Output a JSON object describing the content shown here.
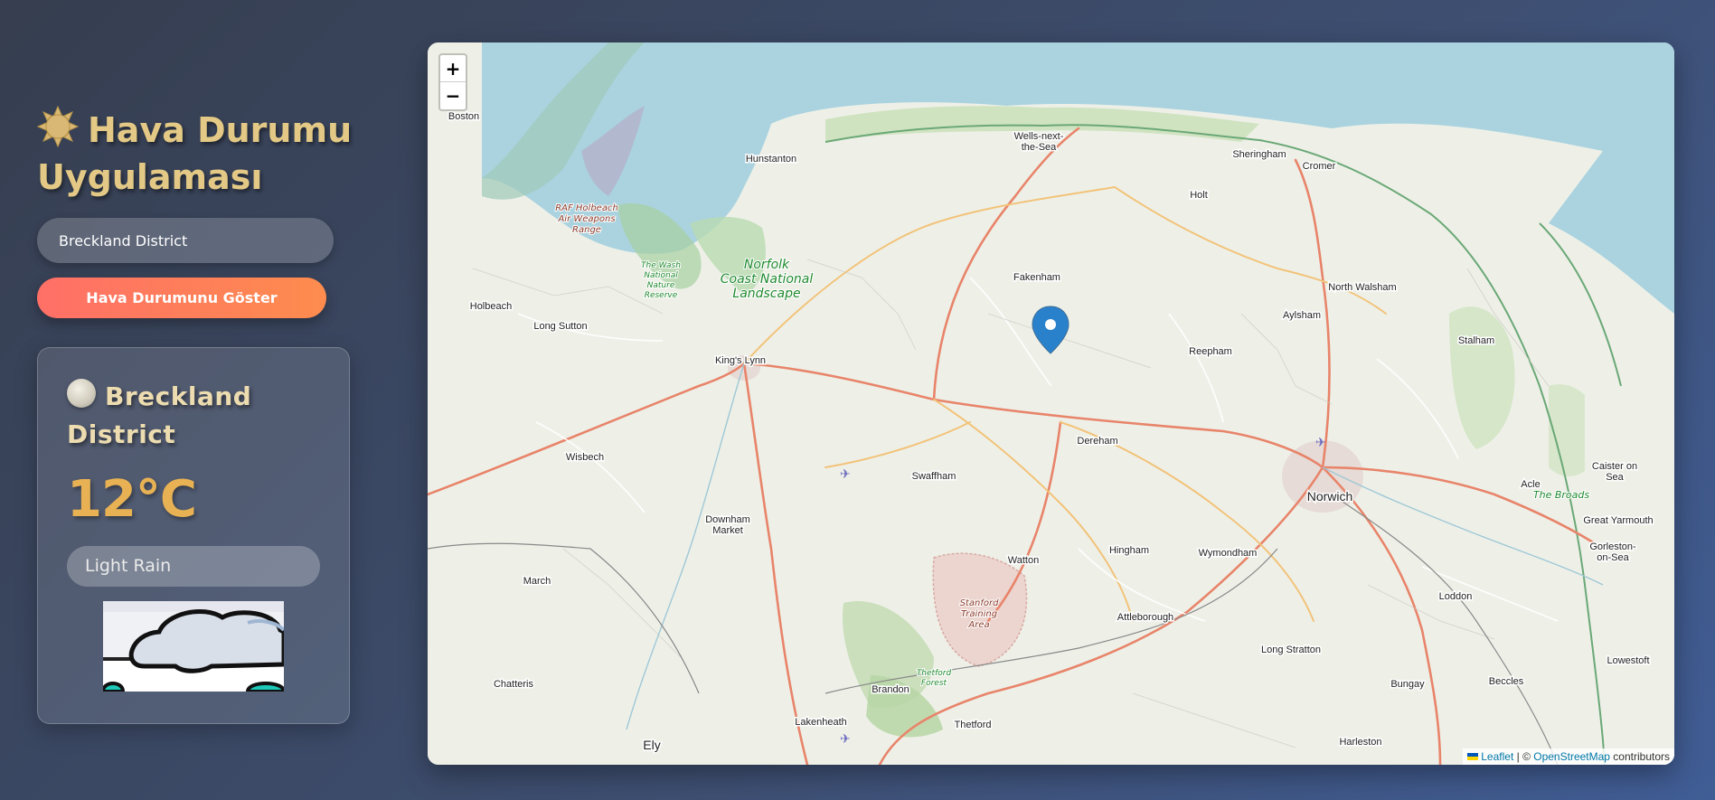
{
  "app": {
    "title": "Hava Durumu Uygulaması",
    "title_icon": "sun-icon"
  },
  "search": {
    "value": "Breckland District",
    "button_label": "Hava Durumunu Göster"
  },
  "weather": {
    "city": "Breckland District",
    "icon": "moon-icon",
    "temperature": "12°C",
    "description": "Light Rain",
    "image": "cloud-rain-icon"
  },
  "map": {
    "zoom_in_label": "+",
    "zoom_out_label": "−",
    "attribution": {
      "leaflet": "Leaflet",
      "separator": " | © ",
      "osm": "OpenStreetMap",
      "suffix": " contributors"
    },
    "places": {
      "boston": "Boston",
      "hunstanton": "Hunstanton",
      "wells1": "Wells-next-",
      "wells2": "the-Sea",
      "sheringham": "Sheringham",
      "cromer": "Cromer",
      "holt": "Holt",
      "holbeach": "Holbeach",
      "long_sutton": "Long Sutton",
      "fakenham": "Fakenham",
      "north_walsham": "North Walsham",
      "aylsham": "Aylsham",
      "stalham": "Stalham",
      "reepham": "Reepham",
      "kings_lynn": "King's Lynn",
      "wisbech": "Wisbech",
      "dereham": "Dereham",
      "swaffham": "Swaffham",
      "caister1": "Caister on",
      "caister2": "Sea",
      "acle": "Acle",
      "norwich": "Norwich",
      "great_yarmouth": "Great Yarmouth",
      "gorleston1": "Gorleston-",
      "gorleston2": "on-Sea",
      "downham1": "Downham",
      "downham2": "Market",
      "watton": "Watton",
      "hingham": "Hingham",
      "wymondham": "Wymondham",
      "march": "March",
      "loddon": "Loddon",
      "attleborough": "Attleborough",
      "long_stratton": "Long Stratton",
      "lowestoft": "Lowestoft",
      "chatteris": "Chatteris",
      "brandon": "Brandon",
      "bungay": "Bungay",
      "beccles": "Beccles",
      "lakenheath": "Lakenheath",
      "thetford": "Thetford",
      "harleston": "Harleston",
      "ely": "Ely"
    },
    "nature_labels": {
      "norfolk1": "Norfolk",
      "norfolk2": "Coast National",
      "norfolk3": "Landscape",
      "wash1": "The Wash",
      "wash2": "National",
      "wash3": "Nature",
      "wash4": "Reserve",
      "broads": "The Broads",
      "thetford_forest1": "Thetford",
      "thetford_forest2": "Forest"
    },
    "area_labels": {
      "raf1": "RAF Holbeach",
      "raf2": "Air Weapons",
      "raf3": "Range",
      "stanford1": "Stanford",
      "stanford2": "Training",
      "stanford3": "Area"
    },
    "colors": {
      "sea": "#aad3df",
      "land": "#eef0e8",
      "primary_road": "#e8846a",
      "secondary_road": "#f2c37a",
      "marker": "#2a81cb"
    }
  }
}
